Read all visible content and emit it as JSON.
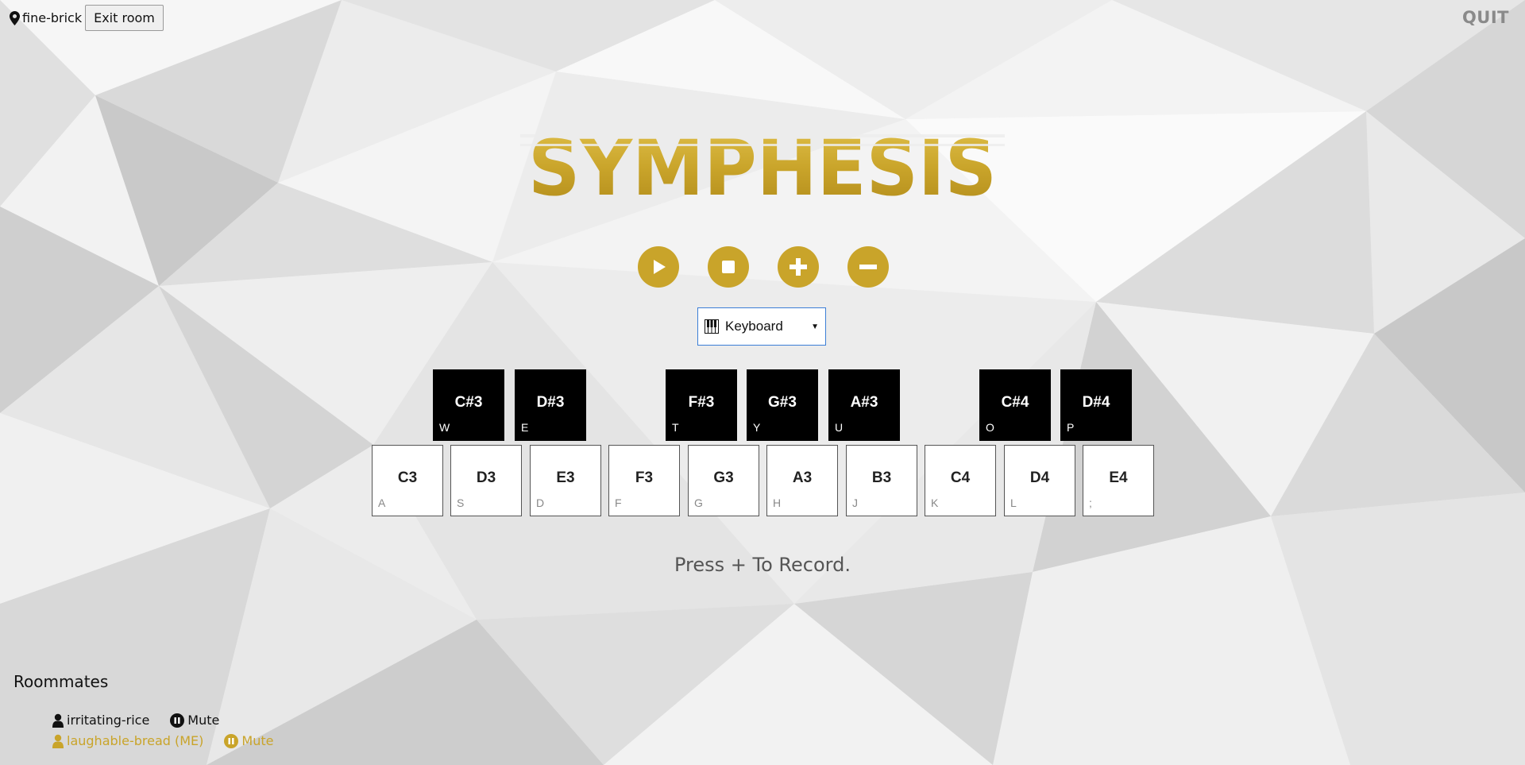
{
  "room": {
    "name": "fine-brick",
    "exit_label": "Exit room",
    "location_icon": "map-pin-icon"
  },
  "quit_label": "QUIT",
  "logo_text": "SYMPHESIS",
  "controls": [
    {
      "name": "play-button",
      "icon": "play-icon"
    },
    {
      "name": "stop-button",
      "icon": "stop-icon"
    },
    {
      "name": "add-button",
      "icon": "plus-icon"
    },
    {
      "name": "remove-button",
      "icon": "minus-icon"
    }
  ],
  "instrument_select": {
    "icon": "piano-keys-icon",
    "value": "Keyboard"
  },
  "keyboard": {
    "white_keys": [
      {
        "note": "C3",
        "key": "A"
      },
      {
        "note": "D3",
        "key": "S"
      },
      {
        "note": "E3",
        "key": "D"
      },
      {
        "note": "F3",
        "key": "F"
      },
      {
        "note": "G3",
        "key": "G"
      },
      {
        "note": "A3",
        "key": "H"
      },
      {
        "note": "B3",
        "key": "J"
      },
      {
        "note": "C4",
        "key": "K"
      },
      {
        "note": "D4",
        "key": "L"
      },
      {
        "note": "E4",
        "key": ";"
      }
    ],
    "black_keys": [
      {
        "note": "C#3",
        "key": "W"
      },
      {
        "note": "D#3",
        "key": "E"
      },
      {
        "note": "F#3",
        "key": "T"
      },
      {
        "note": "G#3",
        "key": "Y"
      },
      {
        "note": "A#3",
        "key": "U"
      },
      {
        "note": "C#4",
        "key": "O"
      },
      {
        "note": "D#4",
        "key": "P"
      }
    ]
  },
  "record_hint": "Press + To Record.",
  "roommates": {
    "title": "Roommates",
    "list": [
      {
        "name": "irritating-rice",
        "mute_label": "Mute",
        "is_me": false
      },
      {
        "name": "laughable-bread (ME)",
        "mute_label": "Mute",
        "is_me": true
      }
    ]
  },
  "colors": {
    "accent": "#c9a42a",
    "background": "#e9e9e9"
  }
}
